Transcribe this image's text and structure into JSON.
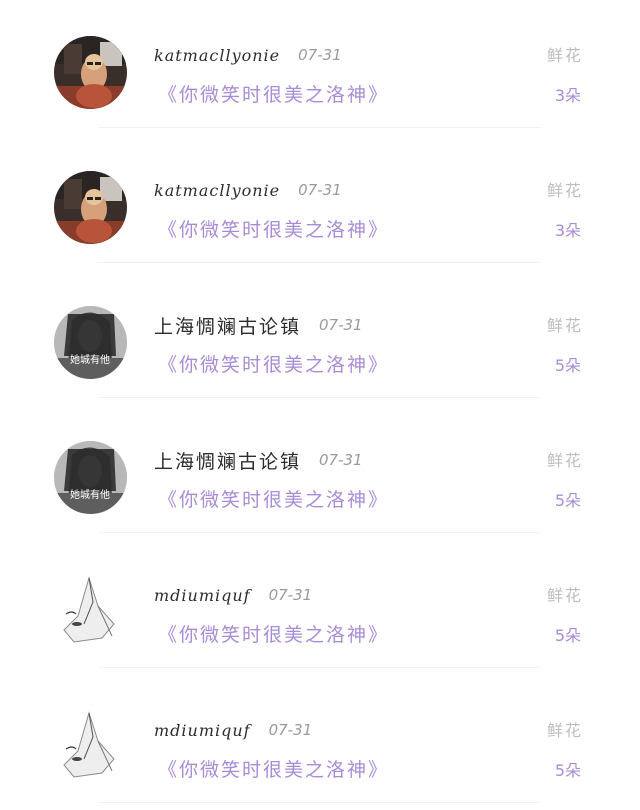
{
  "items": [
    {
      "avatar": "woman-with-glasses-photo",
      "username": "katmacllyonie",
      "date": "07-31",
      "book": "《你微笑时很美之洛神》",
      "gift_label": "鲜花",
      "gift_count": "3朵"
    },
    {
      "avatar": "woman-with-glasses-photo",
      "username": "katmacllyonie",
      "date": "07-31",
      "book": "《你微笑时很美之洛神》",
      "gift_label": "鲜花",
      "gift_count": "3朵"
    },
    {
      "avatar": "dark-hair-girl-photo",
      "avatar_text": "她城有他",
      "username": "上海惆斓古论镇",
      "date": "07-31",
      "book": "《你微笑时很美之洛神》",
      "gift_label": "鲜花",
      "gift_count": "5朵"
    },
    {
      "avatar": "dark-hair-girl-photo",
      "avatar_text": "她城有他",
      "username": "上海惆斓古论镇",
      "date": "07-31",
      "book": "《你微笑时很美之洛神》",
      "gift_label": "鲜花",
      "gift_count": "5朵"
    },
    {
      "avatar": "sketch-figure",
      "username": "mdiumiquf",
      "date": "07-31",
      "book": "《你微笑时很美之洛神》",
      "gift_label": "鲜花",
      "gift_count": "5朵"
    },
    {
      "avatar": "sketch-figure",
      "username": "mdiumiquf",
      "date": "07-31",
      "book": "《你微笑时很美之洛神》",
      "gift_label": "鲜花",
      "gift_count": "5朵"
    }
  ]
}
